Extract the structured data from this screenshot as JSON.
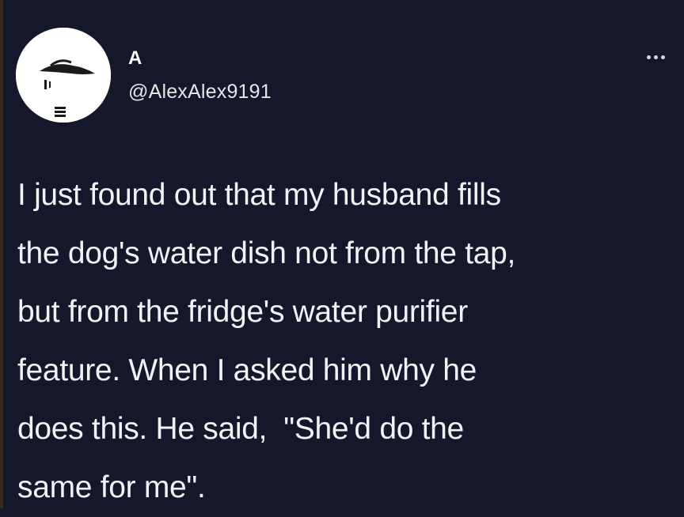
{
  "colors": {
    "background": "#15182a",
    "text": "#f2f2f4",
    "avatar_bg": "#ffffff"
  },
  "author": {
    "display_name": "A",
    "handle": "@AlexAlex9191",
    "avatar_icon": "avatar-icon"
  },
  "menu": {
    "icon": "more-options-icon"
  },
  "tweet": {
    "lines": [
      "I just found out that my husband fills",
      "the dog's water dish not from the tap,",
      "but from the fridge's water purifier",
      "feature. When I asked him why he",
      "does this. He said,  \"She'd do the",
      "same for me\"."
    ]
  }
}
